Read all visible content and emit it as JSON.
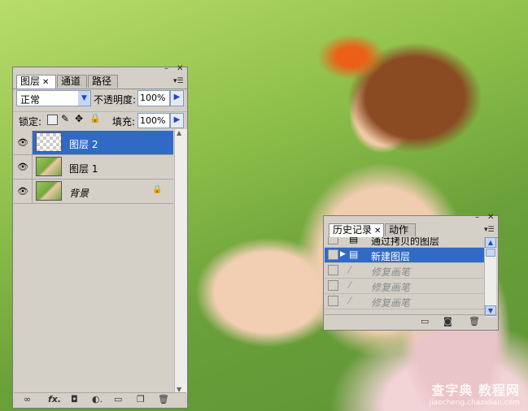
{
  "layers_panel": {
    "tabs": [
      "图层",
      "通道",
      "路径"
    ],
    "blend_mode": "正常",
    "opacity_label": "不透明度:",
    "opacity_value": "100%",
    "lock_label": "锁定:",
    "fill_label": "填充:",
    "fill_value": "100%",
    "layers": [
      {
        "name": "图层 2",
        "selected": true,
        "thumb": "transparent"
      },
      {
        "name": "图层 1",
        "selected": false,
        "thumb": "photo"
      },
      {
        "name": "背景",
        "selected": false,
        "thumb": "photo",
        "locked": true
      }
    ]
  },
  "history_panel": {
    "tabs": [
      "历史记录",
      "动作"
    ],
    "items": [
      {
        "label": "通过拷贝的图层",
        "selected": false,
        "dim": false
      },
      {
        "label": "新建图层",
        "selected": true,
        "dim": false
      },
      {
        "label": "修复画笔",
        "selected": false,
        "dim": true
      },
      {
        "label": "修复画笔",
        "selected": false,
        "dim": true
      },
      {
        "label": "修复画笔",
        "selected": false,
        "dim": true
      }
    ]
  },
  "watermark": {
    "line1": "查字典 教程网",
    "line2": "jiaocheng.chazidian.com"
  },
  "colors": {
    "selection": "#316ac5",
    "panel_bg": "#d4d0c8"
  }
}
